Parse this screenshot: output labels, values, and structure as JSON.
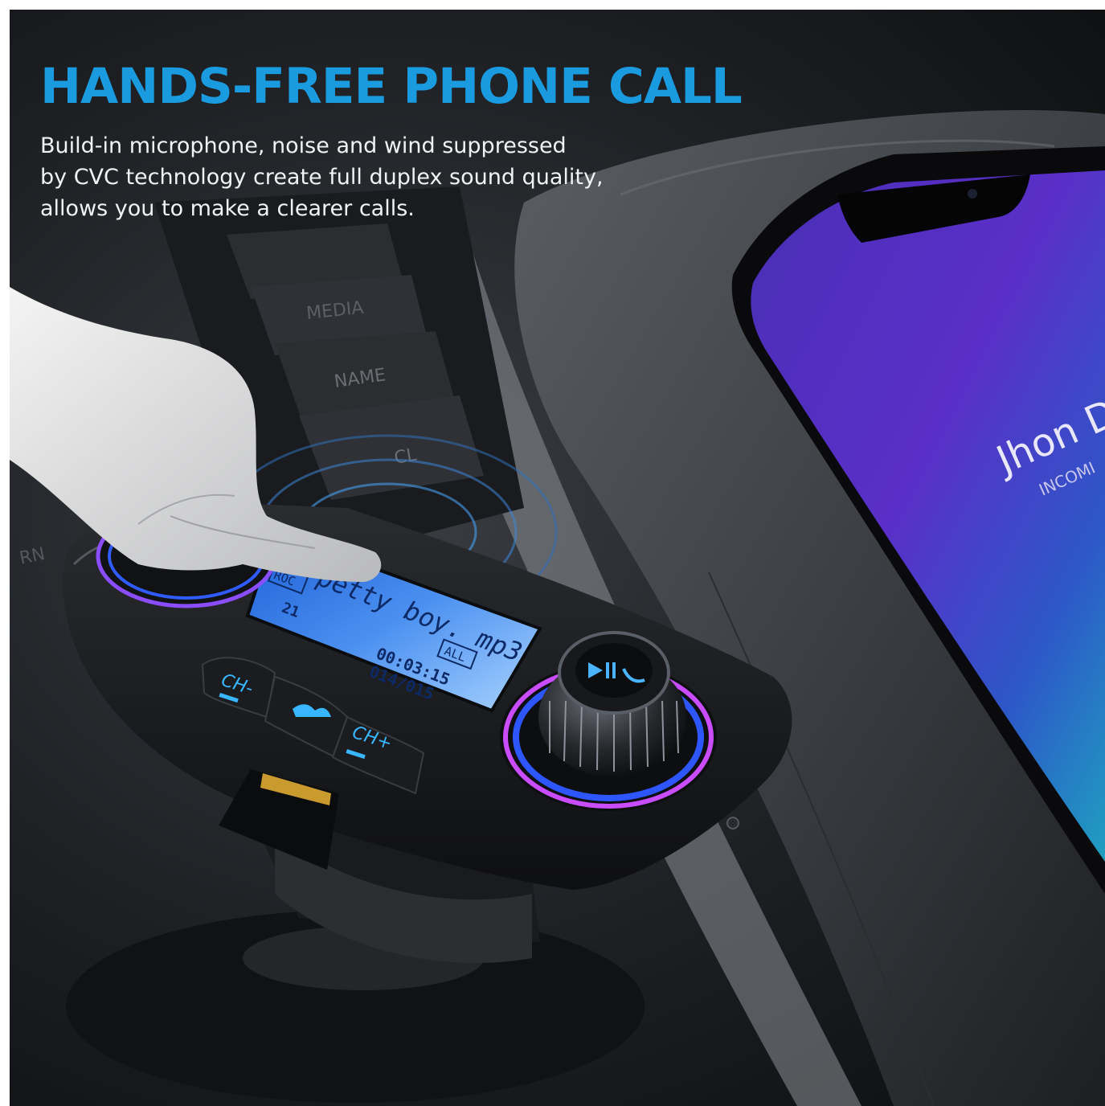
{
  "headline": "HANDS-FREE PHONE CALL",
  "description": [
    "Build-in microphone, noise and wind suppressed",
    "by CVC technology create full duplex sound quality,",
    "allows you to make a clearer calls."
  ],
  "dashboard_buttons": [
    "MEDIA",
    "NAME",
    "CL",
    "RN"
  ],
  "device": {
    "lcd": {
      "genre_tag": "ROC",
      "mode_tag": "ALL",
      "track_name": "petty boy. mp3",
      "number": "21",
      "elapsed_time": "00:03:15",
      "track_position": "014/015"
    },
    "buttons": {
      "prev": "CH-",
      "next": "CH+"
    },
    "knob_icon": "play-pause-call-icon",
    "accent_colors": {
      "lcd": "#2f7fe0",
      "ring_blue": "#2d56ff",
      "ring_purple": "#c94dff",
      "button_glow": "#38b6ff"
    }
  },
  "phone": {
    "caller_name": "Jhon D",
    "call_status": "INCOMI"
  },
  "colors": {
    "headline": "#1a9be0",
    "text": "#f1f2f4"
  }
}
